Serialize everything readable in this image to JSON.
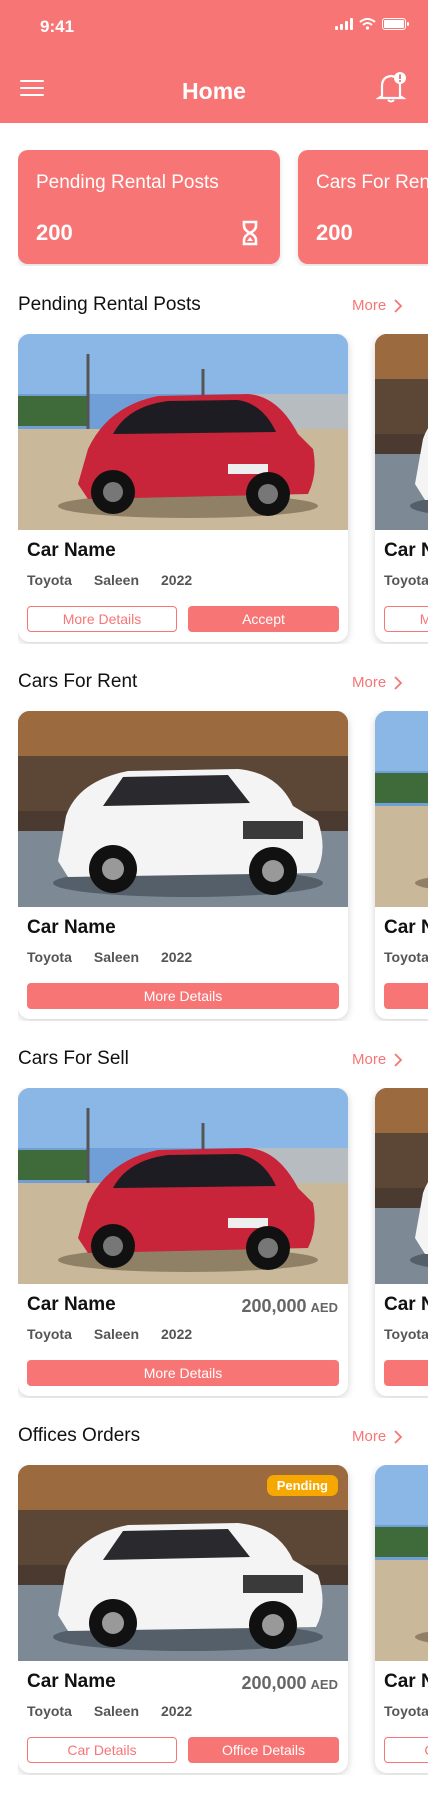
{
  "status_bar": {
    "time": "9:41"
  },
  "header": {
    "title": "Home"
  },
  "stats": [
    {
      "label": "Pending Rental Posts",
      "count": "200"
    },
    {
      "label": "Cars For Rent",
      "count": "200"
    }
  ],
  "sections": [
    {
      "title": "Pending Rental Posts",
      "more": "More",
      "cards": [
        {
          "name": "Car Name",
          "brand": "Toyota",
          "model": "Saleen",
          "year": "2022",
          "left_button": "More Details",
          "right_button": "Accept"
        }
      ],
      "peek": {
        "name": "Car Name",
        "brand": "Toyota",
        "left_button": "More Details"
      }
    },
    {
      "title": "Cars For Rent",
      "more": "More",
      "cards": [
        {
          "name": "Car Name",
          "brand": "Toyota",
          "model": "Saleen",
          "year": "2022",
          "button": "More Details"
        }
      ],
      "peek": {
        "name": "Car Name",
        "brand": "Toyota"
      }
    },
    {
      "title": "Cars For Sell",
      "more": "More",
      "cards": [
        {
          "name": "Car Name",
          "brand": "Toyota",
          "model": "Saleen",
          "year": "2022",
          "price": "200,000",
          "currency": "AED",
          "button": "More Details"
        }
      ],
      "peek": {
        "name": "Car Name",
        "brand": "Toyota"
      }
    },
    {
      "title": "Offices Orders",
      "more": "More",
      "cards": [
        {
          "name": "Car Name",
          "brand": "Toyota",
          "model": "Saleen",
          "year": "2022",
          "price": "200,000",
          "currency": "AED",
          "badge": "Pending",
          "left_button": "Car Details",
          "right_button": "Office Details"
        }
      ],
      "peek": {
        "name": "Car Name",
        "brand": "Toyota",
        "left_button": "Car Details"
      }
    }
  ],
  "icons": {
    "menu": "hamburger-menu-icon",
    "notifications": "bell-icon",
    "pending": "hourglass-icon",
    "more": "chevron-right-icon"
  },
  "colors": {
    "primary": "#f77575",
    "badge": "#f7a800"
  }
}
